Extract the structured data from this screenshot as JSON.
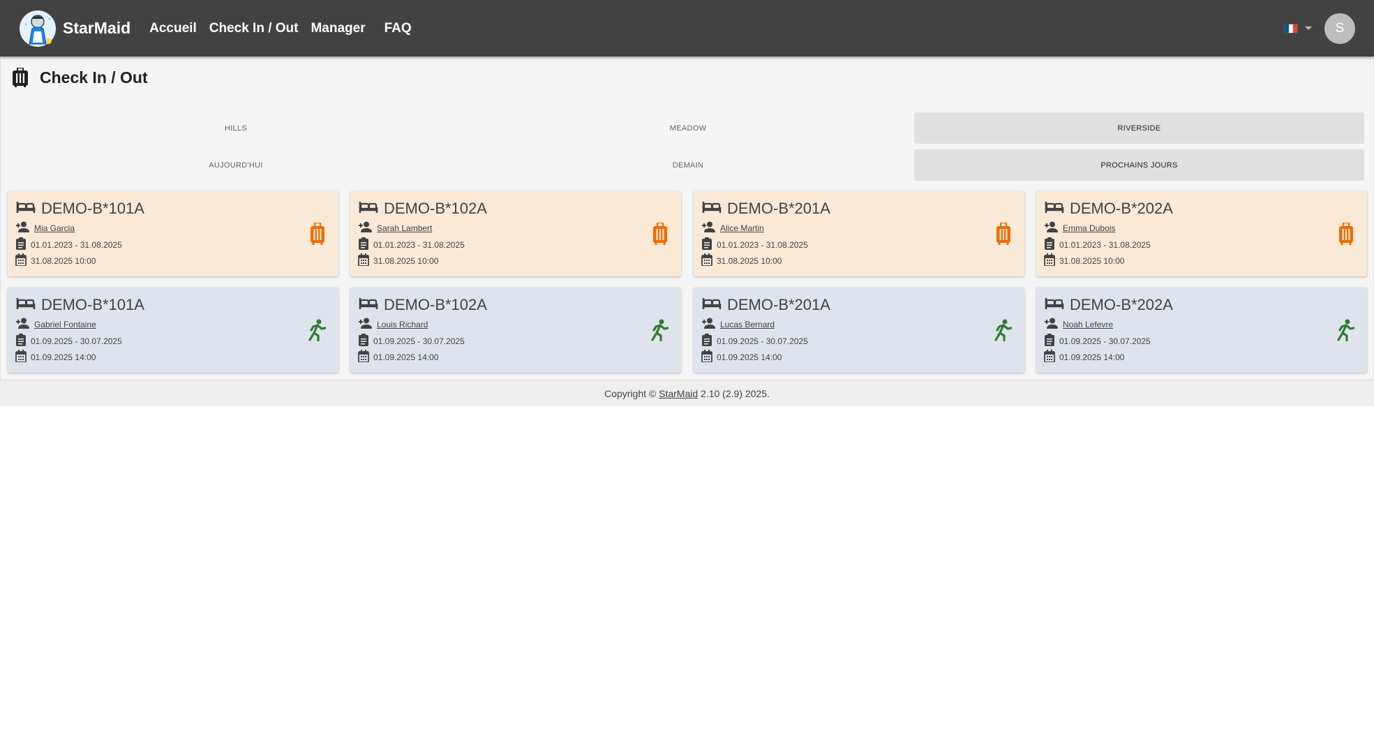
{
  "navbar": {
    "brand": "StarMaid",
    "links": [
      "Accueil",
      "Check In / Out",
      "Manager",
      "FAQ"
    ],
    "language_flag_icon": "france-flag-icon",
    "avatar_initial": "S"
  },
  "page": {
    "title": "Check In / Out",
    "title_icon": "suitcase-icon"
  },
  "building_tabs": {
    "items": [
      "HILLS",
      "MEADOW",
      "RIVERSIDE"
    ],
    "selected": "RIVERSIDE"
  },
  "day_tabs": {
    "items": [
      "AUJOURD'HUI",
      "DEMAIN",
      "PROCHAINS JOURS"
    ],
    "selected": "PROCHAINS JOURS"
  },
  "colors": {
    "checkout_card": "#fbe9d7",
    "checkin_card": "#dfe4ec",
    "checkout_icon": "#ef6c00",
    "checkin_icon": "#2e7d32",
    "navbar": "#424242"
  },
  "checkout_cards": [
    {
      "room": "DEMO-B*101A",
      "guest": "Mia Garcia",
      "period": "01.01.2023 - 31.08.2025",
      "datetime": "31.08.2025 10:00",
      "status_icon": "suitcase-icon"
    },
    {
      "room": "DEMO-B*102A",
      "guest": "Sarah Lambert",
      "period": "01.01.2023 - 31.08.2025",
      "datetime": "31.08.2025 10:00",
      "status_icon": "suitcase-icon"
    },
    {
      "room": "DEMO-B*201A",
      "guest": "Alice Martin",
      "period": "01.01.2023 - 31.08.2025",
      "datetime": "31.08.2025 10:00",
      "status_icon": "suitcase-icon"
    },
    {
      "room": "DEMO-B*202A",
      "guest": "Emma Dubois",
      "period": "01.01.2023 - 31.08.2025",
      "datetime": "31.08.2025 10:00",
      "status_icon": "suitcase-icon"
    }
  ],
  "checkin_cards": [
    {
      "room": "DEMO-B*101A",
      "guest": "Gabriel Fontaine",
      "period": "01.09.2025 - 30.07.2025",
      "datetime": "01.09.2025 14:00",
      "status_icon": "running-person-icon"
    },
    {
      "room": "DEMO-B*102A",
      "guest": "Louis Richard",
      "period": "01.09.2025 - 30.07.2025",
      "datetime": "01.09.2025 14:00",
      "status_icon": "running-person-icon"
    },
    {
      "room": "DEMO-B*201A",
      "guest": "Lucas Bernard",
      "period": "01.09.2025 - 30.07.2025",
      "datetime": "01.09.2025 14:00",
      "status_icon": "running-person-icon"
    },
    {
      "room": "DEMO-B*202A",
      "guest": "Noah Lefevre",
      "period": "01.09.2025 - 30.07.2025",
      "datetime": "01.09.2025 14:00",
      "status_icon": "running-person-icon"
    }
  ],
  "footer": {
    "prefix": "Copyright ©",
    "link": "StarMaid",
    "suffix": "2.10 (2.9) 2025."
  }
}
